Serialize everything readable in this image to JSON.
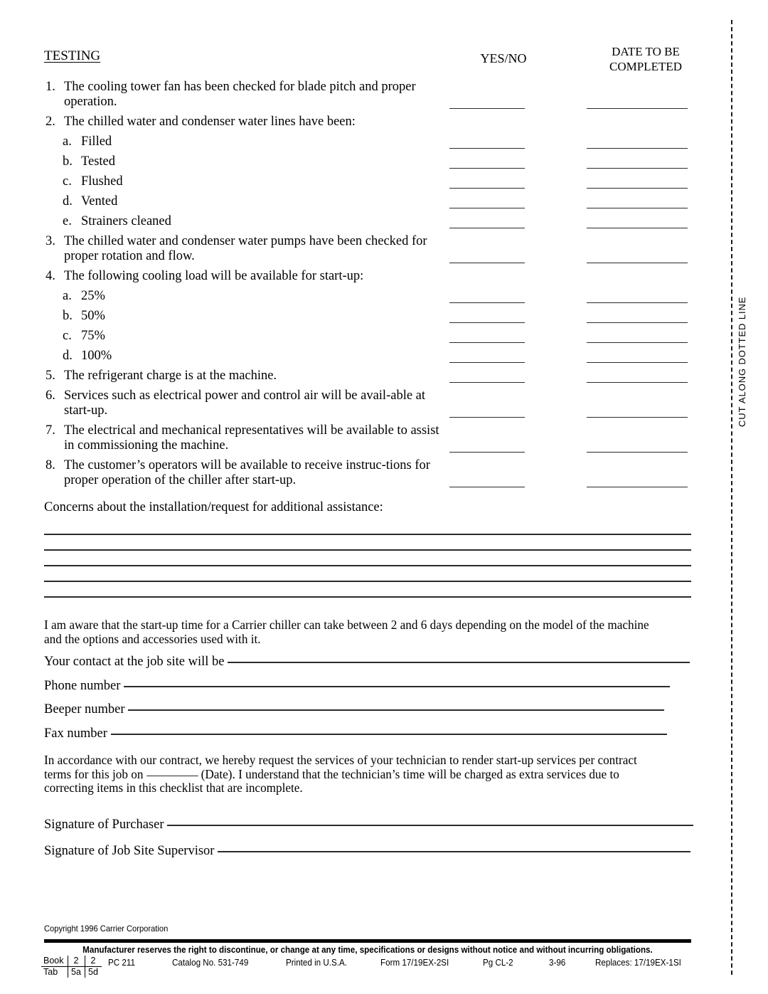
{
  "cut_line": {
    "label": "CUT ALONG DOTTED LINE"
  },
  "headers": {
    "section": "TESTING",
    "yesno": "YES/NO",
    "date_line1": "DATE TO BE",
    "date_line2": "COMPLETED"
  },
  "checklist": [
    {
      "num": "1.",
      "text": "The cooling tower fan has been checked for blade pitch and proper operation.",
      "sub": false,
      "lines": 2
    },
    {
      "num": "2.",
      "text": "The chilled water and condenser water lines have been:",
      "sub": false,
      "lines": 1,
      "no_blank": true
    },
    {
      "num": "a.",
      "text": "Filled",
      "sub": true,
      "lines": 1
    },
    {
      "num": "b.",
      "text": "Tested",
      "sub": true,
      "lines": 1
    },
    {
      "num": "c.",
      "text": "Flushed",
      "sub": true,
      "lines": 1
    },
    {
      "num": "d.",
      "text": "Vented",
      "sub": true,
      "lines": 1
    },
    {
      "num": "e.",
      "text": "Strainers cleaned",
      "sub": true,
      "lines": 1
    },
    {
      "num": "3.",
      "text": "The chilled water and condenser water pumps have been checked for proper rotation and flow.",
      "sub": false,
      "lines": 2
    },
    {
      "num": "4.",
      "text": "The following cooling load will be available for start-up:",
      "sub": false,
      "lines": 1,
      "no_blank": true
    },
    {
      "num": "a.",
      "text": "25%",
      "sub": true,
      "lines": 1
    },
    {
      "num": "b.",
      "text": "50%",
      "sub": true,
      "lines": 1
    },
    {
      "num": "c.",
      "text": "75%",
      "sub": true,
      "lines": 1
    },
    {
      "num": "d.",
      "text": "100%",
      "sub": true,
      "lines": 1
    },
    {
      "num": "5.",
      "text": "The refrigerant charge is at the machine.",
      "sub": false,
      "lines": 1
    },
    {
      "num": "6.",
      "text": "Services such as electrical power and control air will be avail-able at start-up.",
      "sub": false,
      "lines": 2
    },
    {
      "num": "7.",
      "text": "The electrical and mechanical representatives will be available to assist in commissioning the machine.",
      "sub": false,
      "lines": 2
    },
    {
      "num": "8.",
      "text": "The customer’s operators will be available to receive instruc-tions for proper operation of the chiller after start-up.",
      "sub": false,
      "lines": 2
    }
  ],
  "concerns": {
    "label": "Concerns about the installation/request for additional assistance:",
    "line_count": 5
  },
  "awareness_paragraph": "I am aware that the start-up time for a Carrier chiller can take between 2 and 6 days depending on the model of the machine and the options and accessories used with it.",
  "contact_fields": [
    {
      "label": "Your contact at the job site will be",
      "line_width": 650
    },
    {
      "label": "Phone number",
      "line_width": 768
    },
    {
      "label": "Beeper number",
      "line_width": 754
    },
    {
      "label": "Fax number",
      "line_width": 782
    }
  ],
  "contract_paragraph": {
    "before_blank": "In accordance with our contract, we hereby request the services of your technician to render start-up services per contract terms for this job on",
    "after_blank": "(Date). I understand that the technician’s time will be charged as extra services due to correcting items in this checklist that are incomplete."
  },
  "signature_fields": [
    {
      "label": "Signature of Purchaser",
      "line_width": 740
    },
    {
      "label": "Signature of Job Site Supervisor",
      "line_width": 665
    }
  ],
  "footer": {
    "copyright": "Copyright 1996 Carrier Corporation",
    "disclaimer": "Manufacturer reserves the right to discontinue, or change at any time, specifications or designs without notice and without incurring obligations.",
    "book_label": "Book",
    "book_values": [
      "2",
      "2"
    ],
    "tab_label": "Tab",
    "tab_values": [
      "5a",
      "5d"
    ],
    "pc": "PC 211",
    "catalog": "Catalog No. 531-749",
    "printed": "Printed in U.S.A.",
    "form": "Form 17/19EX-2SI",
    "page": "Pg CL-2",
    "date": "3-96",
    "replaces": "Replaces: 17/19EX-1SI"
  }
}
